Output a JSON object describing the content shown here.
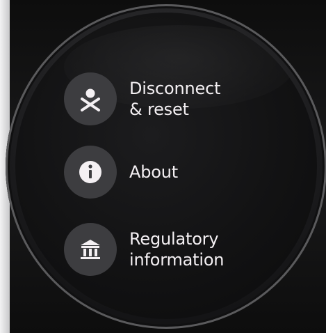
{
  "menu": {
    "items": [
      {
        "label": "Disconnect\n& reset",
        "icon": "disconnect-reset-icon"
      },
      {
        "label": "About",
        "icon": "info-icon"
      },
      {
        "label": "Regulatory\ninformation",
        "icon": "regulatory-building-icon"
      }
    ]
  },
  "colors": {
    "background": "#121213",
    "icon_circle": "#3d3d40",
    "text": "#f4f0f3"
  }
}
